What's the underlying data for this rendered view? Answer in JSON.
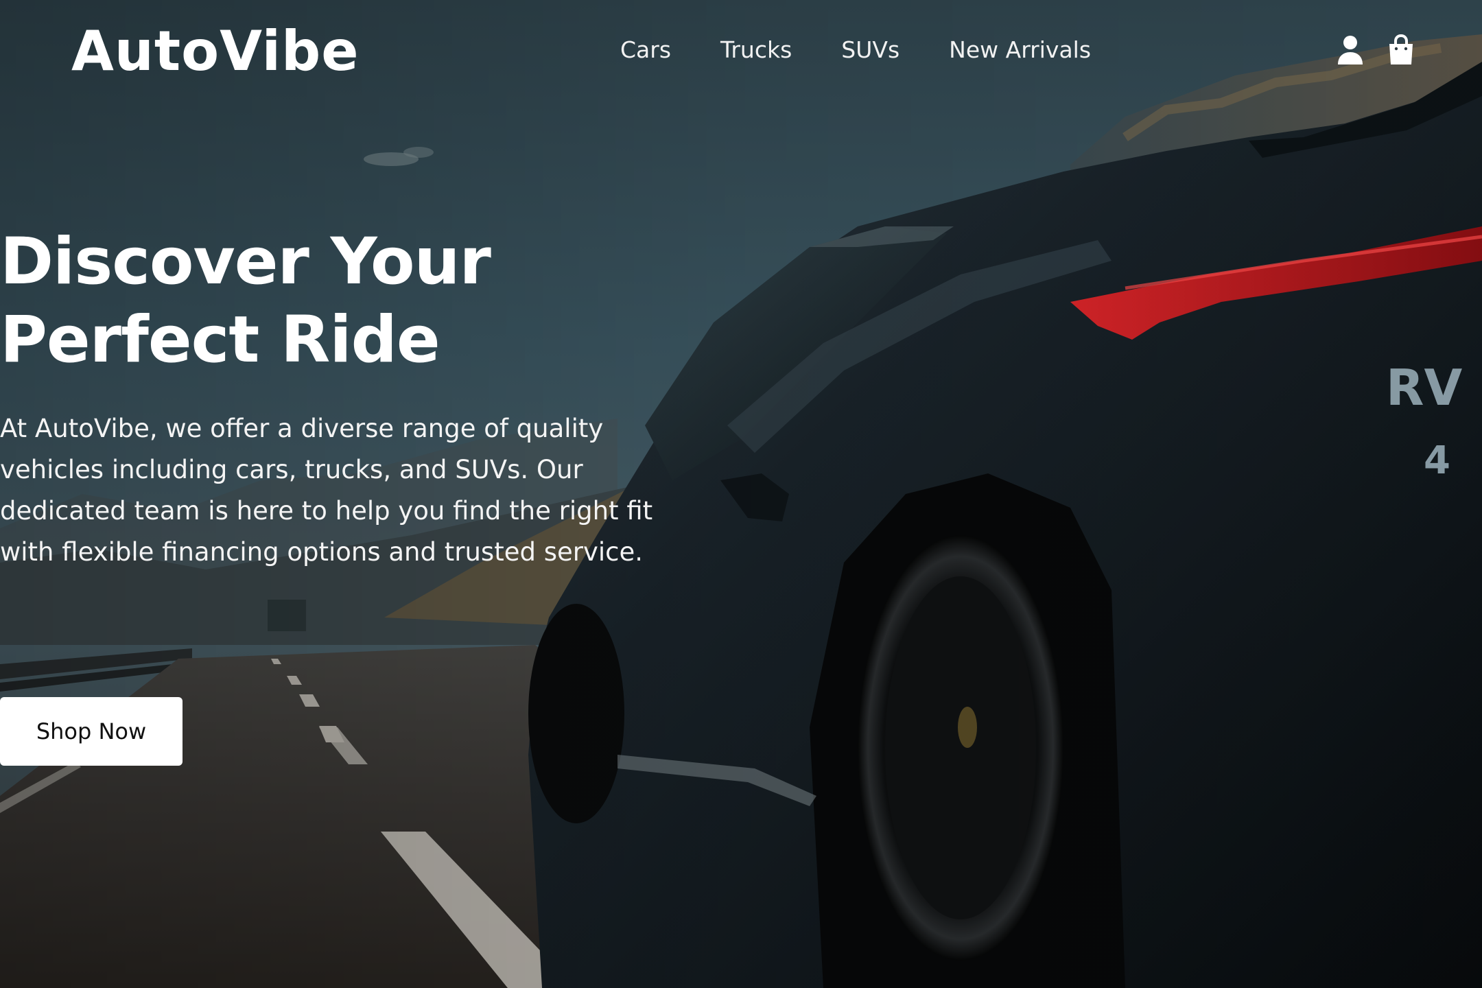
{
  "brand": {
    "name": "AutoVibe"
  },
  "nav": {
    "items": [
      {
        "label": "Cars"
      },
      {
        "label": "Trucks"
      },
      {
        "label": "SUVs"
      },
      {
        "label": "New Arrivals"
      }
    ]
  },
  "header_icons": [
    "user-icon",
    "shopping-bag-icon"
  ],
  "hero": {
    "title_line1": "Discover Your",
    "title_line2": "Perfect Ride",
    "body_lines": [
      "At AutoVibe, we offer a diverse range of quality",
      "vehicles including cars, trucks, and SUVs. Our",
      "dedicated team is here to help you find the right fit",
      "with flexible financing options and trusted service."
    ],
    "cta_label": "Shop Now"
  },
  "car_badge": {
    "text_1": "RV",
    "text_2": "4"
  },
  "colors": {
    "sky": "#3d5a66",
    "car_body": "#141c22",
    "tail_light": "#c0161b",
    "cta_bg": "#ffffff",
    "text": "#ffffff"
  }
}
